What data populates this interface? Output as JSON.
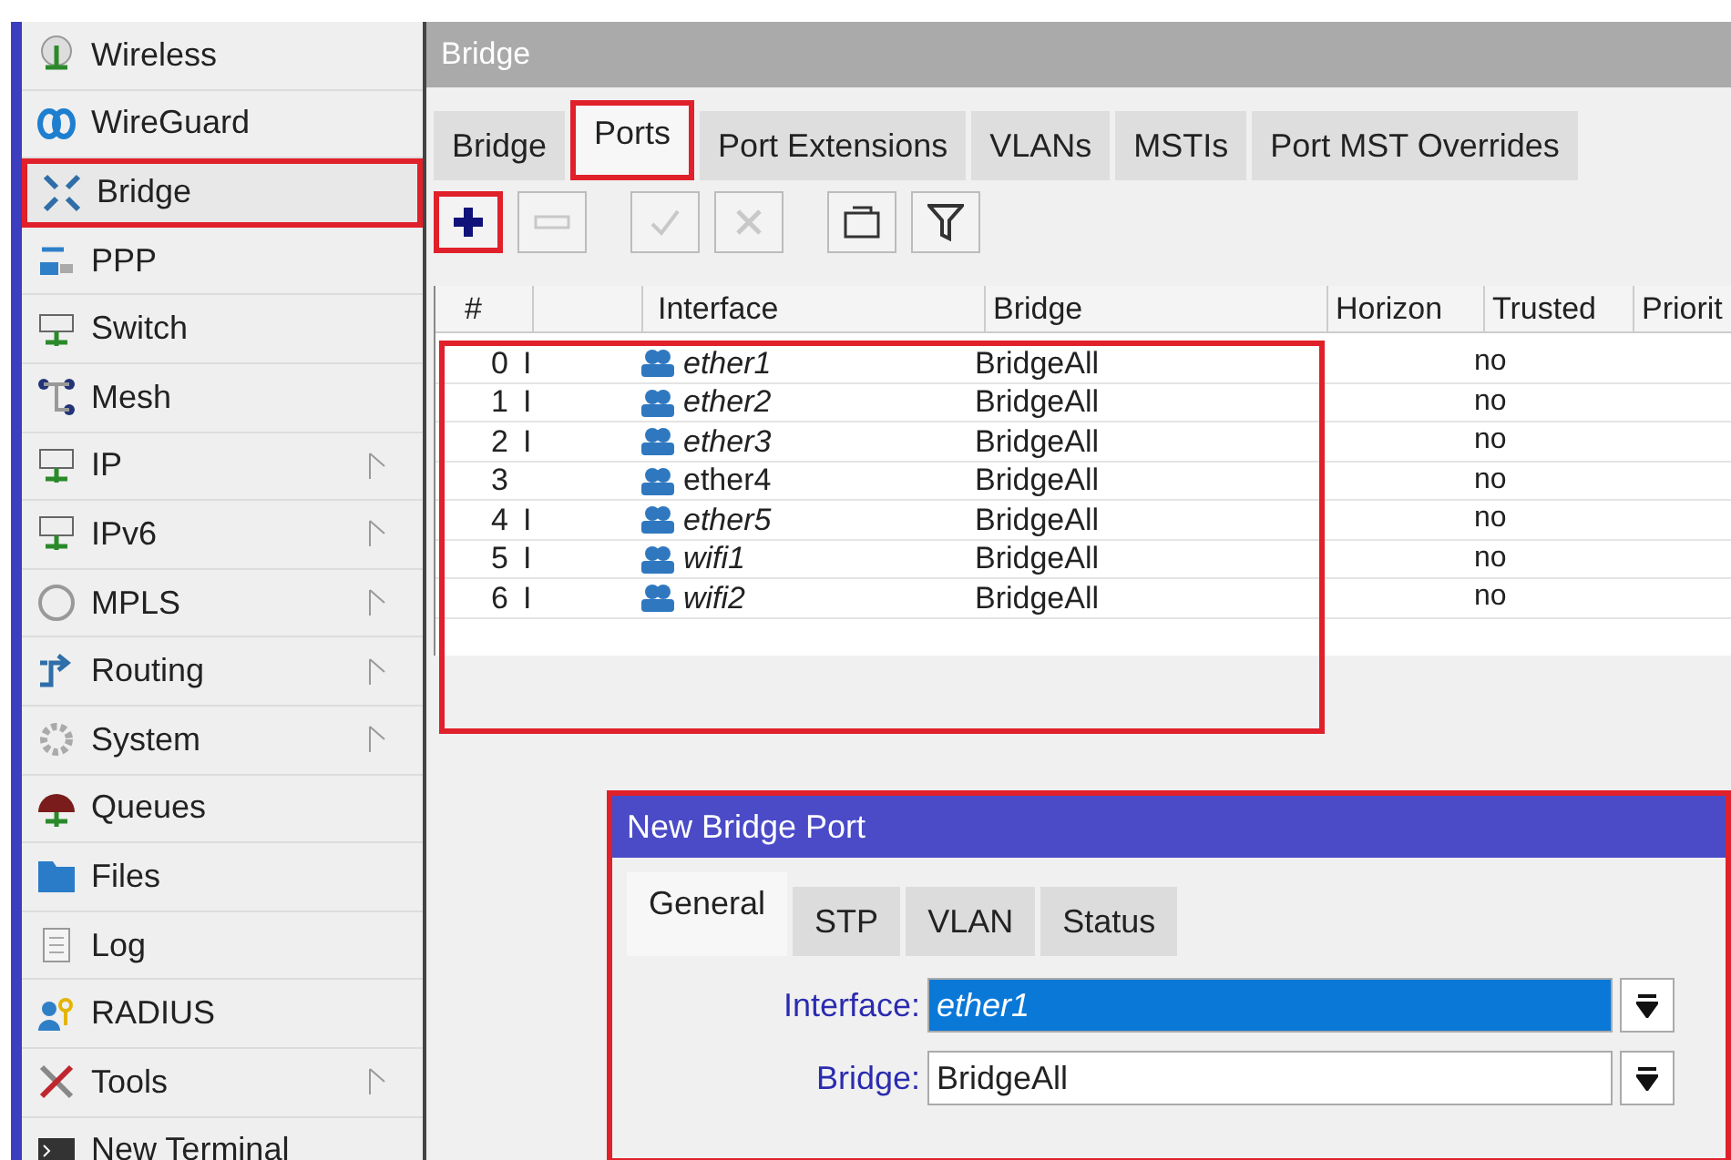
{
  "sidebar": {
    "items": [
      {
        "label": "Wireless",
        "submenu": false,
        "selected": false
      },
      {
        "label": "WireGuard",
        "submenu": false,
        "selected": false
      },
      {
        "label": "Bridge",
        "submenu": false,
        "selected": true
      },
      {
        "label": "PPP",
        "submenu": false,
        "selected": false
      },
      {
        "label": "Switch",
        "submenu": false,
        "selected": false
      },
      {
        "label": "Mesh",
        "submenu": false,
        "selected": false
      },
      {
        "label": "IP",
        "submenu": true,
        "selected": false
      },
      {
        "label": "IPv6",
        "submenu": true,
        "selected": false
      },
      {
        "label": "MPLS",
        "submenu": true,
        "selected": false
      },
      {
        "label": "Routing",
        "submenu": true,
        "selected": false
      },
      {
        "label": "System",
        "submenu": true,
        "selected": false
      },
      {
        "label": "Queues",
        "submenu": false,
        "selected": false
      },
      {
        "label": "Files",
        "submenu": false,
        "selected": false
      },
      {
        "label": "Log",
        "submenu": false,
        "selected": false
      },
      {
        "label": "RADIUS",
        "submenu": false,
        "selected": false
      },
      {
        "label": "Tools",
        "submenu": true,
        "selected": false
      },
      {
        "label": "New Terminal",
        "submenu": false,
        "selected": false
      }
    ]
  },
  "window": {
    "title": "Bridge",
    "tabs": [
      {
        "label": "Bridge",
        "selected": false
      },
      {
        "label": "Ports",
        "selected": true
      },
      {
        "label": "Port Extensions",
        "selected": false
      },
      {
        "label": "VLANs",
        "selected": false
      },
      {
        "label": "MSTIs",
        "selected": false
      },
      {
        "label": "Port MST Overrides",
        "selected": false
      }
    ],
    "toolbar": [
      {
        "kind": "add",
        "disabled": false,
        "highlighted": true
      },
      {
        "kind": "remove",
        "disabled": true,
        "highlighted": false
      },
      {
        "kind": "enable",
        "disabled": true,
        "highlighted": false
      },
      {
        "kind": "disable",
        "disabled": true,
        "highlighted": false
      },
      {
        "kind": "comment",
        "disabled": false,
        "highlighted": false
      },
      {
        "kind": "filter",
        "disabled": false,
        "highlighted": false
      }
    ],
    "table": {
      "columns": [
        "#",
        "",
        "Interface",
        "Bridge",
        "Horizon",
        "Trusted",
        "Priorit"
      ],
      "rows": [
        {
          "index": "0",
          "flag": "I",
          "inactive": true,
          "interface": "ether1",
          "bridge": "BridgeAll",
          "trusted": "no"
        },
        {
          "index": "1",
          "flag": "I",
          "inactive": true,
          "interface": "ether2",
          "bridge": "BridgeAll",
          "trusted": "no"
        },
        {
          "index": "2",
          "flag": "I",
          "inactive": true,
          "interface": "ether3",
          "bridge": "BridgeAll",
          "trusted": "no"
        },
        {
          "index": "3",
          "inactive": false,
          "interface": "ether4",
          "bridge": "BridgeAll",
          "trusted": "no"
        },
        {
          "index": "4",
          "flag": "I",
          "inactive": true,
          "interface": "ether5",
          "bridge": "BridgeAll",
          "trusted": "no"
        },
        {
          "index": "5",
          "flag": "I",
          "inactive": true,
          "interface": "wifi1",
          "bridge": "BridgeAll",
          "trusted": "no"
        },
        {
          "index": "6",
          "flag": "I",
          "inactive": true,
          "interface": "wifi2",
          "bridge": "BridgeAll",
          "trusted": "no"
        }
      ]
    }
  },
  "dialog": {
    "title": "New Bridge Port",
    "tabs": [
      {
        "label": "General",
        "selected": true
      },
      {
        "label": "STP",
        "selected": false
      },
      {
        "label": "VLAN",
        "selected": false
      },
      {
        "label": "Status",
        "selected": false
      }
    ],
    "fields": [
      {
        "label": "Interface:",
        "value": "ether1",
        "selected": true
      },
      {
        "label": "Bridge:",
        "value": "BridgeAll",
        "selected": false
      }
    ]
  }
}
